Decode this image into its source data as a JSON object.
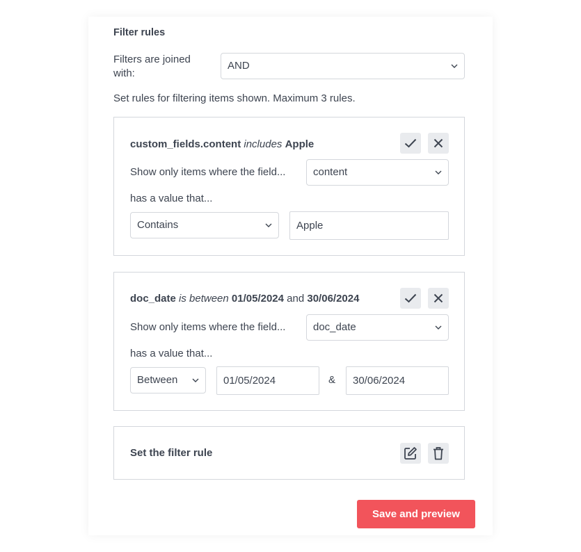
{
  "panel": {
    "title": "Filter rules",
    "join_label": "Filters are joined with:",
    "join_value": "AND",
    "description": "Set rules for filtering items shown. Maximum 3 rules."
  },
  "rules": [
    {
      "heading_field": "custom_fields.content",
      "heading_op": "includes",
      "heading_value": "Apple",
      "field_label": "Show only items where the field...",
      "field_value": "content",
      "value_label": "has a value that...",
      "operator_value": "Contains",
      "input_value": "Apple"
    },
    {
      "heading_field": "doc_date",
      "heading_op": "is between",
      "heading_value_1": "01/05/2024",
      "heading_and": "and",
      "heading_value_2": "30/06/2024",
      "field_label": "Show only items where the field...",
      "field_value": "doc_date",
      "value_label": "has a value that...",
      "operator_value": "Between",
      "input_value_1": "01/05/2024",
      "amp": "&",
      "input_value_2": "30/06/2024"
    }
  ],
  "empty_rule": {
    "label": "Set the filter rule"
  },
  "save_button": "Save and preview",
  "icons": {
    "confirm": "check-icon",
    "cancel": "close-icon",
    "edit": "edit-icon",
    "delete": "trash-icon",
    "dropdown": "chevron-down-icon"
  },
  "colors": {
    "primary_button": "#f2545b",
    "icon_button_bg": "#e9ebee",
    "text": "#3d4450",
    "border": "#d4d7dc"
  }
}
